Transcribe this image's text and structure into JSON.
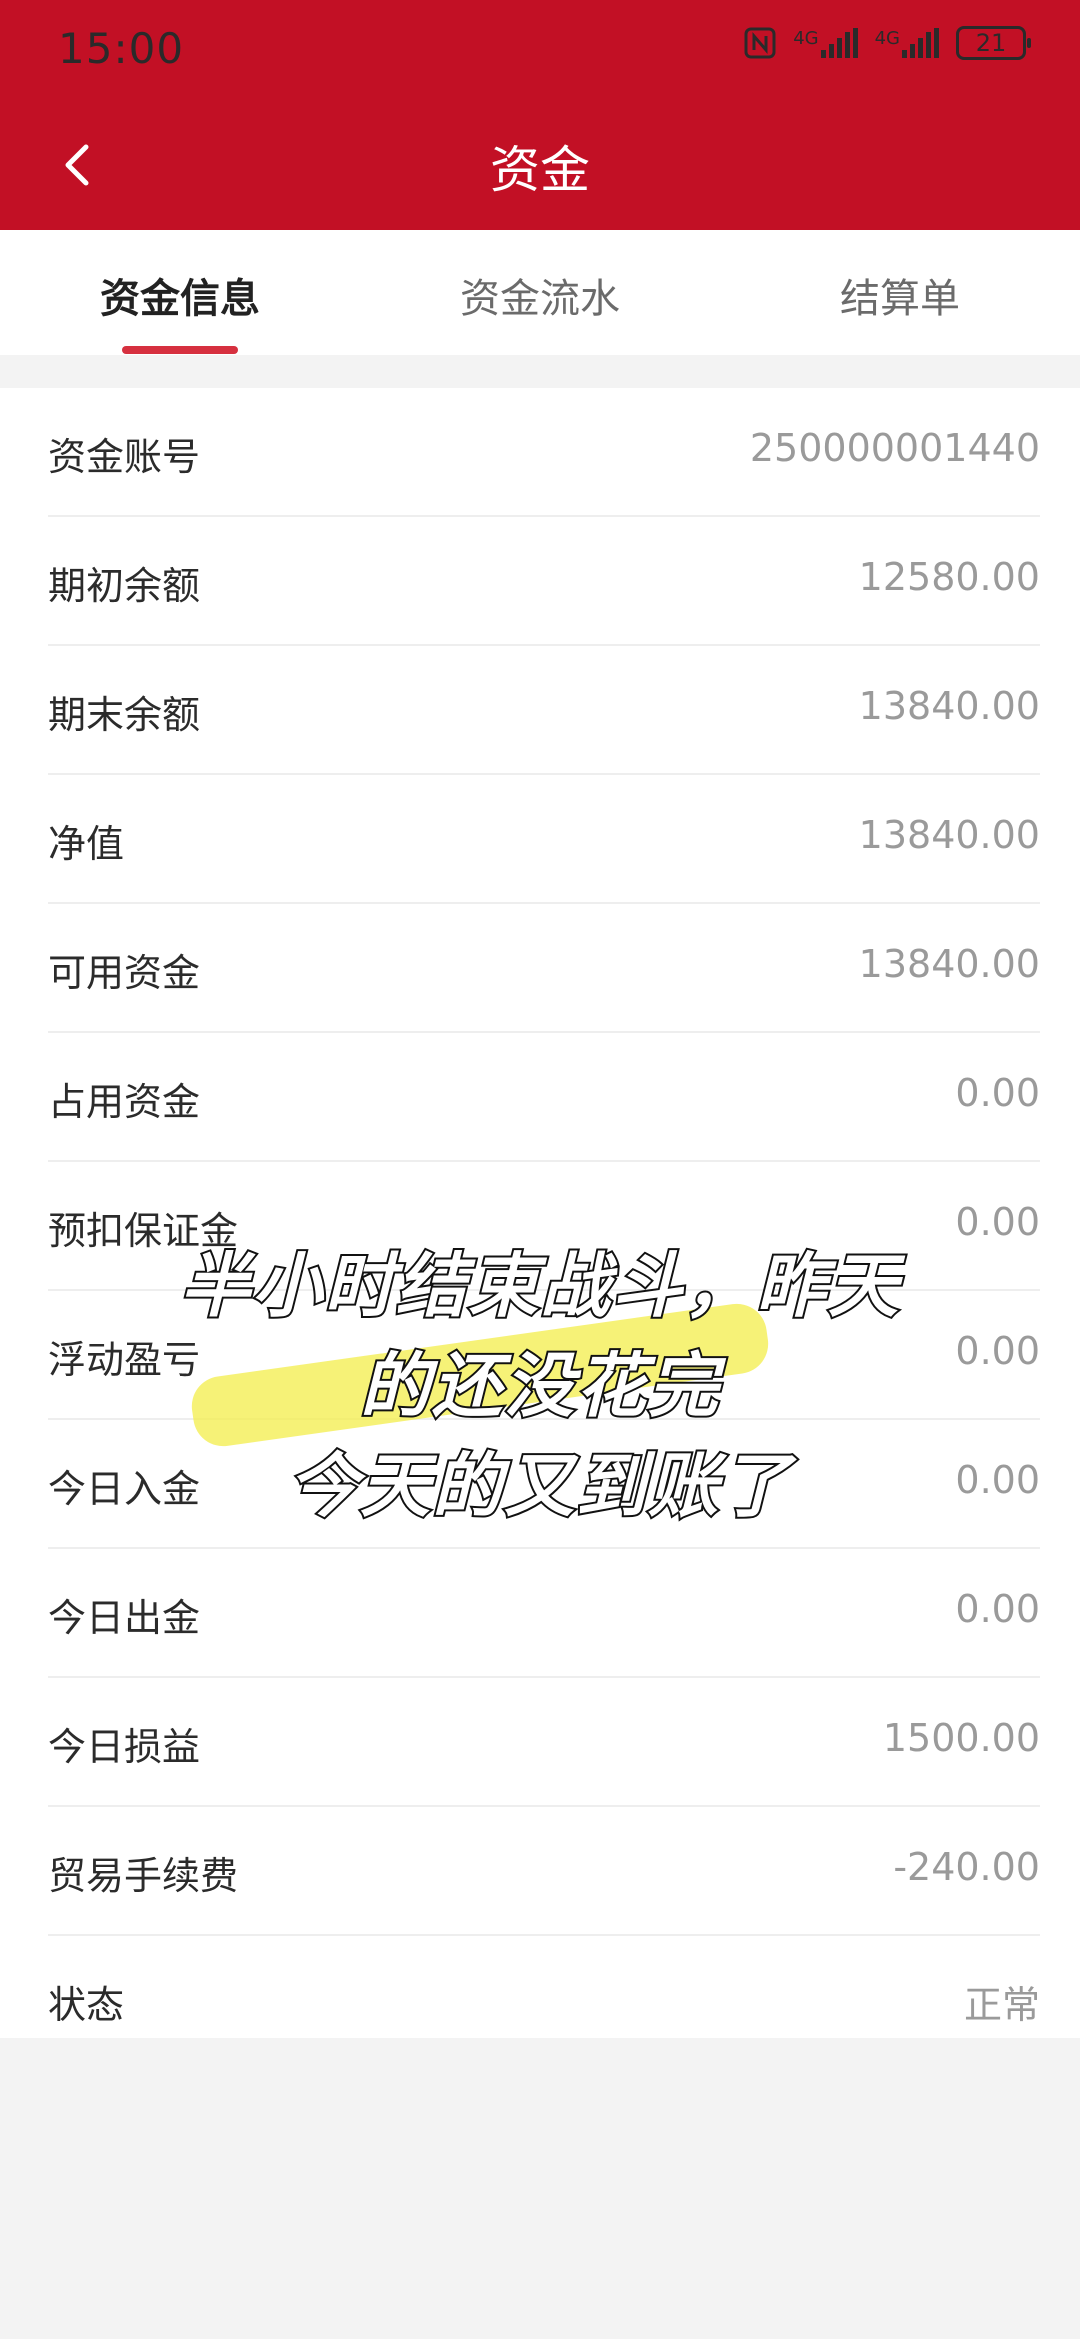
{
  "status_bar": {
    "time": "15:00",
    "network1": "4G",
    "network2": "4G",
    "battery": "21"
  },
  "header": {
    "title": "资金"
  },
  "tabs": [
    {
      "label": "资金信息",
      "active": true
    },
    {
      "label": "资金流水",
      "active": false
    },
    {
      "label": "结算单",
      "active": false
    }
  ],
  "rows": [
    {
      "label": "资金账号",
      "value": "250000001440"
    },
    {
      "label": "期初余额",
      "value": "12580.00"
    },
    {
      "label": "期末余额",
      "value": "13840.00"
    },
    {
      "label": "净值",
      "value": "13840.00"
    },
    {
      "label": "可用资金",
      "value": "13840.00"
    },
    {
      "label": "占用资金",
      "value": "0.00"
    },
    {
      "label": "预扣保证金",
      "value": "0.00"
    },
    {
      "label": "浮动盈亏",
      "value": "0.00"
    },
    {
      "label": "今日入金",
      "value": "0.00"
    },
    {
      "label": "今日出金",
      "value": "0.00"
    },
    {
      "label": "今日损益",
      "value": "1500.00"
    },
    {
      "label": "贸易手续费",
      "value": "-240.00"
    },
    {
      "label": "状态",
      "value": "正常"
    }
  ],
  "overlay_caption": {
    "line1": "半小时结束战斗，昨天",
    "line2": "的还没花完",
    "line3": "今天的又到账了"
  },
  "colors": {
    "brand_red": "#c21025",
    "tab_underline": "#d6303f",
    "highlight_yellow": "#f3ee4a"
  }
}
